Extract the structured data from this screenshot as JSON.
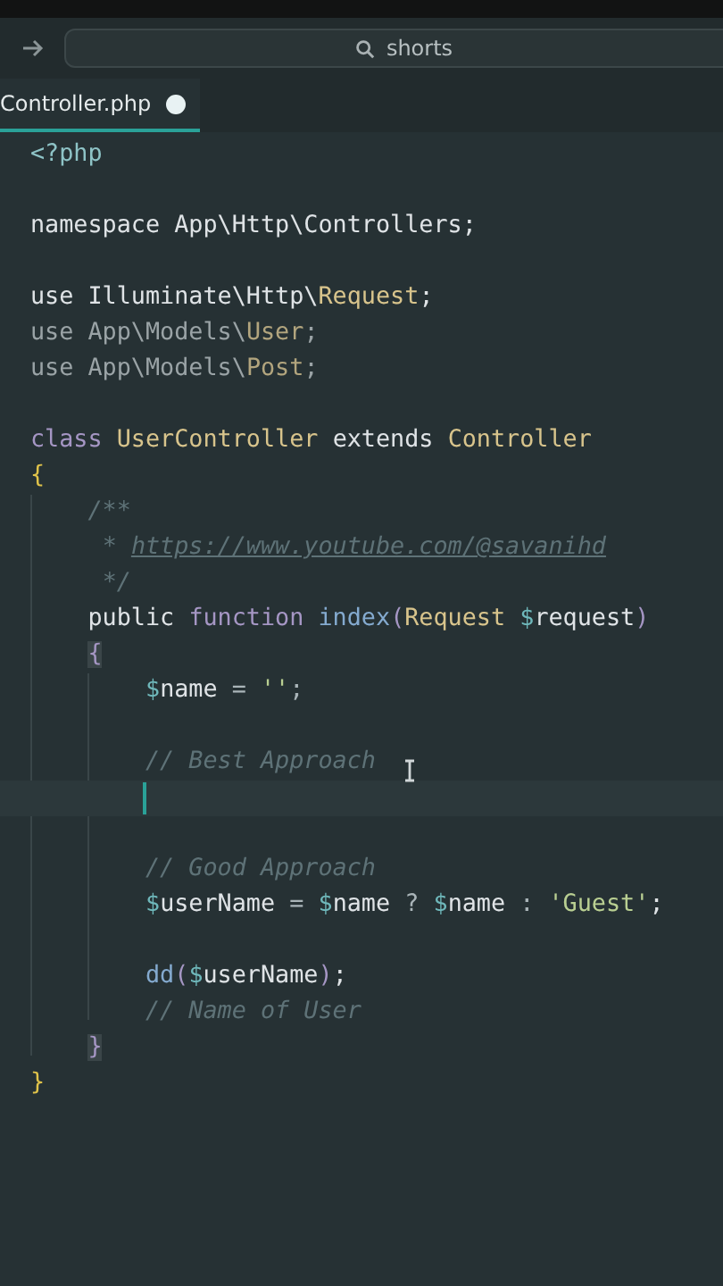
{
  "address_bar": {
    "query": "shorts"
  },
  "tab": {
    "label": "Controller.php",
    "modified": true,
    "selected": true
  },
  "editor": {
    "lines": [
      {
        "kind": "code",
        "current": false,
        "tokens": [
          {
            "text": "<?php",
            "kind": "tag"
          }
        ]
      },
      {
        "kind": "blank",
        "current": false
      },
      {
        "kind": "code",
        "current": false,
        "tokens": [
          {
            "text": "namespace App\\Http\\Controllers;",
            "kind": "plain"
          }
        ]
      },
      {
        "kind": "blank",
        "current": false
      },
      {
        "kind": "code",
        "current": false,
        "tokens": [
          {
            "text": "use Illuminate\\Http\\",
            "kind": "plain"
          },
          {
            "text": "Request",
            "kind": "class"
          },
          {
            "text": ";",
            "kind": "plain"
          }
        ]
      },
      {
        "kind": "code",
        "current": false,
        "tokens": [
          {
            "text": "use App\\Models\\",
            "kind": "dim"
          },
          {
            "text": "User",
            "kind": "dim-class"
          },
          {
            "text": ";",
            "kind": "dim"
          }
        ]
      },
      {
        "kind": "code",
        "current": false,
        "tokens": [
          {
            "text": "use App\\Models\\",
            "kind": "dim"
          },
          {
            "text": "Post",
            "kind": "dim-class"
          },
          {
            "text": ";",
            "kind": "dim"
          }
        ]
      },
      {
        "kind": "blank",
        "current": false
      },
      {
        "kind": "code",
        "current": false,
        "tokens": [
          {
            "text": "class",
            "kind": "keyword"
          },
          {
            "text": " UserController",
            "kind": "class"
          },
          {
            "text": " extends",
            "kind": "plain"
          },
          {
            "text": " Controller",
            "kind": "class"
          }
        ]
      },
      {
        "kind": "code",
        "current": false,
        "tokens": [
          {
            "text": "{",
            "kind": "brace"
          }
        ]
      },
      {
        "kind": "code",
        "current": false,
        "tokens": [
          {
            "text": "    /**",
            "kind": "comment"
          }
        ]
      },
      {
        "kind": "code",
        "current": false,
        "tokens": [
          {
            "text": "     *",
            "kind": "comment"
          },
          {
            "text": " https://www.youtube.com/@savanihd",
            "kind": "link"
          }
        ]
      },
      {
        "kind": "code",
        "current": false,
        "tokens": [
          {
            "text": "     */",
            "kind": "comment"
          }
        ]
      },
      {
        "kind": "code",
        "current": false,
        "tokens": [
          {
            "text": "    public",
            "kind": "plain"
          },
          {
            "text": " function",
            "kind": "keyword"
          },
          {
            "text": " index",
            "kind": "func"
          },
          {
            "text": "(",
            "kind": "paren"
          },
          {
            "text": "Request",
            "kind": "class"
          },
          {
            "text": " $",
            "kind": "sigil"
          },
          {
            "text": "request",
            "kind": "plain"
          },
          {
            "text": ")",
            "kind": "paren"
          }
        ]
      },
      {
        "kind": "code",
        "current": false,
        "tokens": [
          {
            "text": "    {",
            "kind": "brace-match"
          }
        ]
      },
      {
        "kind": "code",
        "current": false,
        "tokens": [
          {
            "text": "        $",
            "kind": "sigil"
          },
          {
            "text": "name",
            "kind": "plain"
          },
          {
            "text": " =",
            "kind": "op"
          },
          {
            "text": " ''",
            "kind": "string"
          },
          {
            "text": ";",
            "kind": "op"
          }
        ]
      },
      {
        "kind": "blank",
        "current": false
      },
      {
        "kind": "code",
        "current": false,
        "tokens": [
          {
            "text": "        // Best Approach",
            "kind": "comment"
          }
        ]
      },
      {
        "kind": "blank",
        "current": true
      },
      {
        "kind": "blank",
        "current": false
      },
      {
        "kind": "code",
        "current": false,
        "tokens": [
          {
            "text": "        // Good Approach",
            "kind": "comment"
          }
        ]
      },
      {
        "kind": "code",
        "current": false,
        "tokens": [
          {
            "text": "        $",
            "kind": "sigil"
          },
          {
            "text": "userName",
            "kind": "plain"
          },
          {
            "text": " =",
            "kind": "op"
          },
          {
            "text": " $",
            "kind": "sigil"
          },
          {
            "text": "name",
            "kind": "plain"
          },
          {
            "text": " ?",
            "kind": "op"
          },
          {
            "text": " $",
            "kind": "sigil"
          },
          {
            "text": "name",
            "kind": "plain"
          },
          {
            "text": " :",
            "kind": "op"
          },
          {
            "text": " 'Guest'",
            "kind": "string"
          },
          {
            "text": ";",
            "kind": "plain"
          }
        ]
      },
      {
        "kind": "blank",
        "current": false
      },
      {
        "kind": "code",
        "current": false,
        "tokens": [
          {
            "text": "        dd",
            "kind": "func"
          },
          {
            "text": "(",
            "kind": "paren"
          },
          {
            "text": "$",
            "kind": "sigil"
          },
          {
            "text": "userName",
            "kind": "plain"
          },
          {
            "text": ")",
            "kind": "paren"
          },
          {
            "text": ";",
            "kind": "plain"
          }
        ]
      },
      {
        "kind": "code",
        "current": false,
        "tokens": [
          {
            "text": "        // Name of User",
            "kind": "comment"
          }
        ]
      },
      {
        "kind": "code",
        "current": false,
        "tokens": [
          {
            "text": "    }",
            "kind": "brace-match"
          }
        ]
      },
      {
        "kind": "code",
        "current": false,
        "tokens": [
          {
            "text": "}",
            "kind": "brace"
          }
        ]
      }
    ]
  }
}
